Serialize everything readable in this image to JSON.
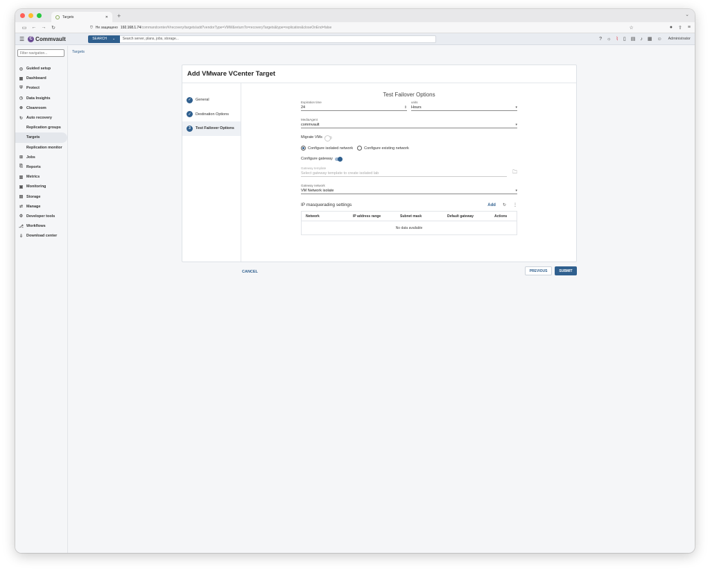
{
  "browser": {
    "tab_title": "Targets",
    "url_security": "Не защищено",
    "url_host": "192.168.1.74",
    "url_path": "/commandcenter/#/recovery/targets/add?vendorType=VMW&returnTo=recoveryTargets&type=replication&closeOnEnd=false",
    "colors": {
      "close": "#ff5f57",
      "min": "#febc2e",
      "max": "#28c840"
    }
  },
  "header": {
    "brand": "Commvault",
    "search_label": "SEARCH",
    "search_placeholder": "Search server, plans, jobs, storage...",
    "user": "Administrator"
  },
  "sidebar": {
    "filter_placeholder": "Filter navigation...",
    "items": [
      {
        "label": "Guided setup",
        "icon": "compass-icon",
        "glyph": "◎"
      },
      {
        "label": "Dashboard",
        "icon": "dashboard-icon",
        "glyph": "▦"
      },
      {
        "label": "Protect",
        "icon": "protect-icon",
        "glyph": "⛨"
      },
      {
        "label": "Data Insights",
        "icon": "insights-icon",
        "glyph": "◷"
      },
      {
        "label": "Cleanroom",
        "icon": "cleanroom-icon",
        "glyph": "⊛"
      },
      {
        "label": "Auto recovery",
        "icon": "recovery-icon",
        "glyph": "↻"
      }
    ],
    "sub_items": [
      {
        "label": "Replication groups"
      },
      {
        "label": "Targets"
      },
      {
        "label": "Replication monitor"
      }
    ],
    "items2": [
      {
        "label": "Jobs",
        "icon": "jobs-icon",
        "glyph": "⊞"
      },
      {
        "label": "Reports",
        "icon": "reports-icon",
        "glyph": "⎘"
      },
      {
        "label": "Metrics",
        "icon": "metrics-icon",
        "glyph": "▥"
      },
      {
        "label": "Monitoring",
        "icon": "monitoring-icon",
        "glyph": "▣"
      },
      {
        "label": "Storage",
        "icon": "storage-icon",
        "glyph": "▤"
      },
      {
        "label": "Manage",
        "icon": "manage-icon",
        "glyph": "⇄"
      },
      {
        "label": "Developer tools",
        "icon": "developer-icon",
        "glyph": "⚙"
      },
      {
        "label": "Workflows",
        "icon": "workflows-icon",
        "glyph": "⎇"
      },
      {
        "label": "Download center",
        "icon": "download-icon",
        "glyph": "⇩"
      }
    ]
  },
  "breadcrumb": "Targets",
  "wizard": {
    "title": "Add VMware VCenter Target",
    "steps": [
      {
        "label": "General",
        "state": "done"
      },
      {
        "label": "Destination Options",
        "state": "done"
      },
      {
        "label": "Test Failover Options",
        "state": "current",
        "number": "3"
      }
    ],
    "section_title": "Test Failover Options",
    "expiration_label": "Expiration time",
    "expiration_value": "24",
    "units_label": "units",
    "units_value": "Hours",
    "mediaagent_label": "MediaAgent",
    "mediaagent_value": "commvault",
    "migrate_label": "Migrate VMs",
    "radio_isolated": "Configure isolated network",
    "radio_existing": "Configure existing network",
    "gateway_toggle_label": "Configure gateway",
    "gateway_template_label": "Gateway template",
    "gateway_template_placeholder": "Select gateway template to create isolated lab",
    "gateway_network_label": "Gateway network",
    "gateway_network_value": "VM Network isolate",
    "ip_title": "IP masquerading settings",
    "ip_add": "Add",
    "columns": [
      "Network",
      "IP address range",
      "Subnet mask",
      "Default gateway",
      "Actions"
    ],
    "empty_text": "No data available"
  },
  "footer": {
    "cancel": "CANCEL",
    "previous": "PREVIOUS",
    "submit": "SUBMIT"
  }
}
